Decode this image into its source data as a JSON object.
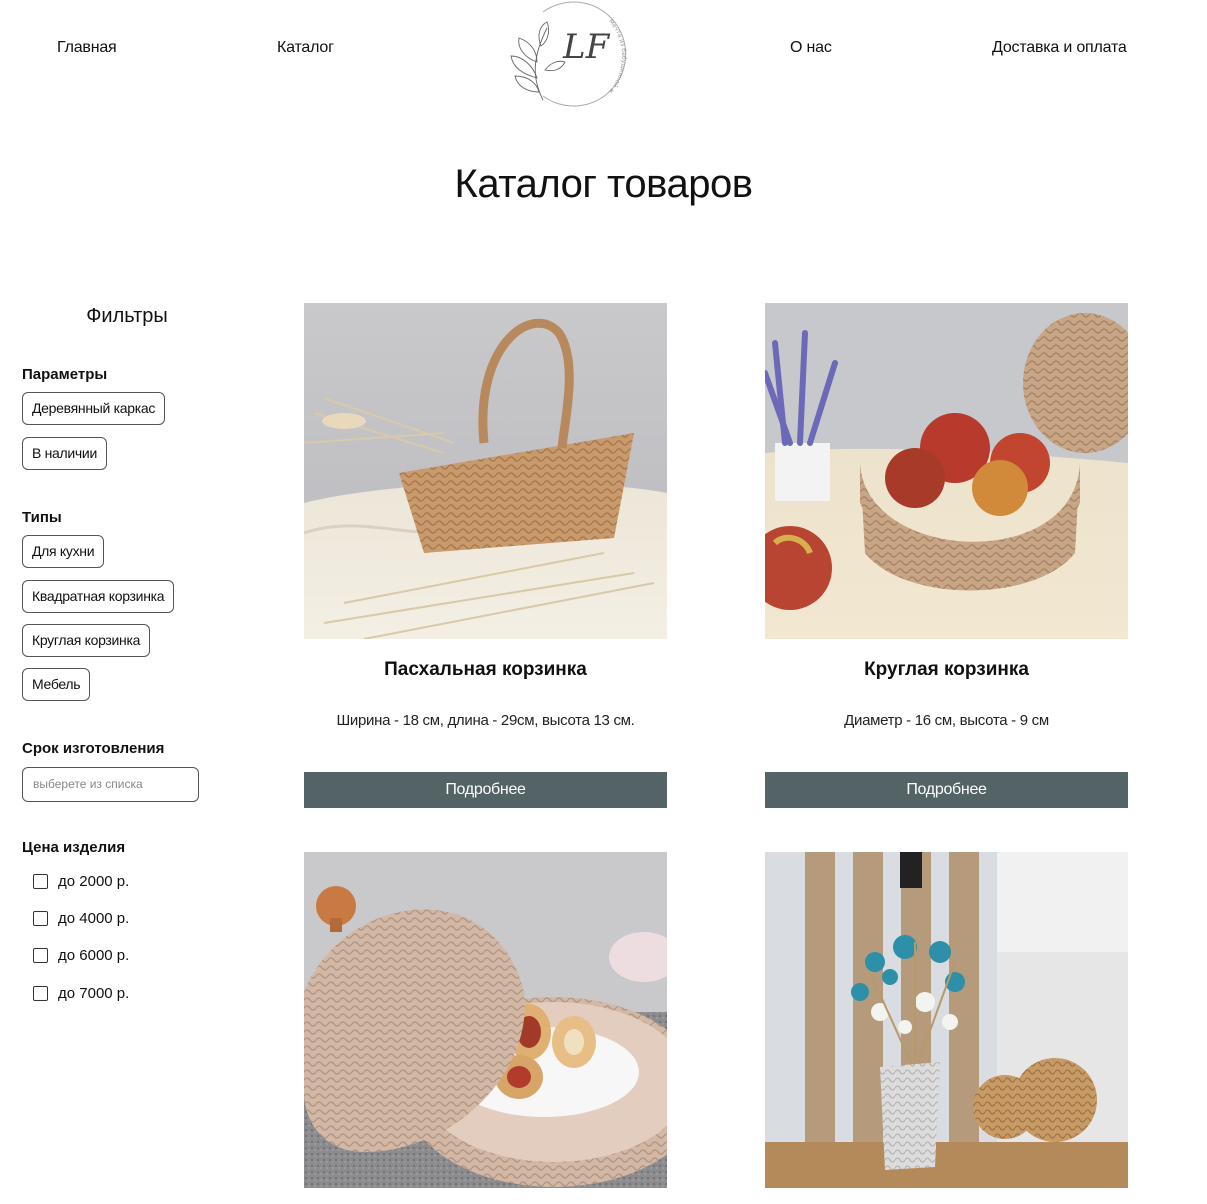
{
  "nav": {
    "home": "Главная",
    "catalog": "Каталог",
    "about": "О нас",
    "delivery": "Доставка и оплата",
    "logo_letters": "LF",
    "logo_arc_text": "Мечта из бабушкиной жизни"
  },
  "page_title": "Каталог товаров",
  "filters": {
    "title": "Фильтры",
    "params_title": "Параметры",
    "params": [
      "Деревянный каркас",
      "В наличии"
    ],
    "types_title": "Типы",
    "types": [
      "Для кухни",
      "Квадратная корзинка",
      "Круглая корзинка",
      "Мебель"
    ],
    "term_title": "Срок изготовления",
    "term_placeholder": "выберете из списка",
    "price_title": "Цена изделия",
    "prices": [
      "до 2000 р.",
      "до 4000 р.",
      "до 6000 р.",
      "до 7000 р."
    ]
  },
  "products": [
    {
      "title": "Пасхальная корзинка",
      "description": "Ширина - 18 см, длина - 29см, высота 13 см.",
      "button": "Подробнее",
      "image": "easter-basket-photo"
    },
    {
      "title": "Круглая корзинка",
      "description": "Диаметр - 16 см, высота - 9 см",
      "button": "Подробнее",
      "image": "round-basket-apples-photo"
    },
    {
      "title": "",
      "description": "",
      "button": "",
      "image": "bread-basket-lid-photo"
    },
    {
      "title": "",
      "description": "",
      "button": "",
      "image": "woven-vase-flowers-photo"
    }
  ],
  "colors": {
    "button_bg": "#546365",
    "button_text": "#ffffff",
    "text": "#111111",
    "chip_border": "#555555"
  }
}
